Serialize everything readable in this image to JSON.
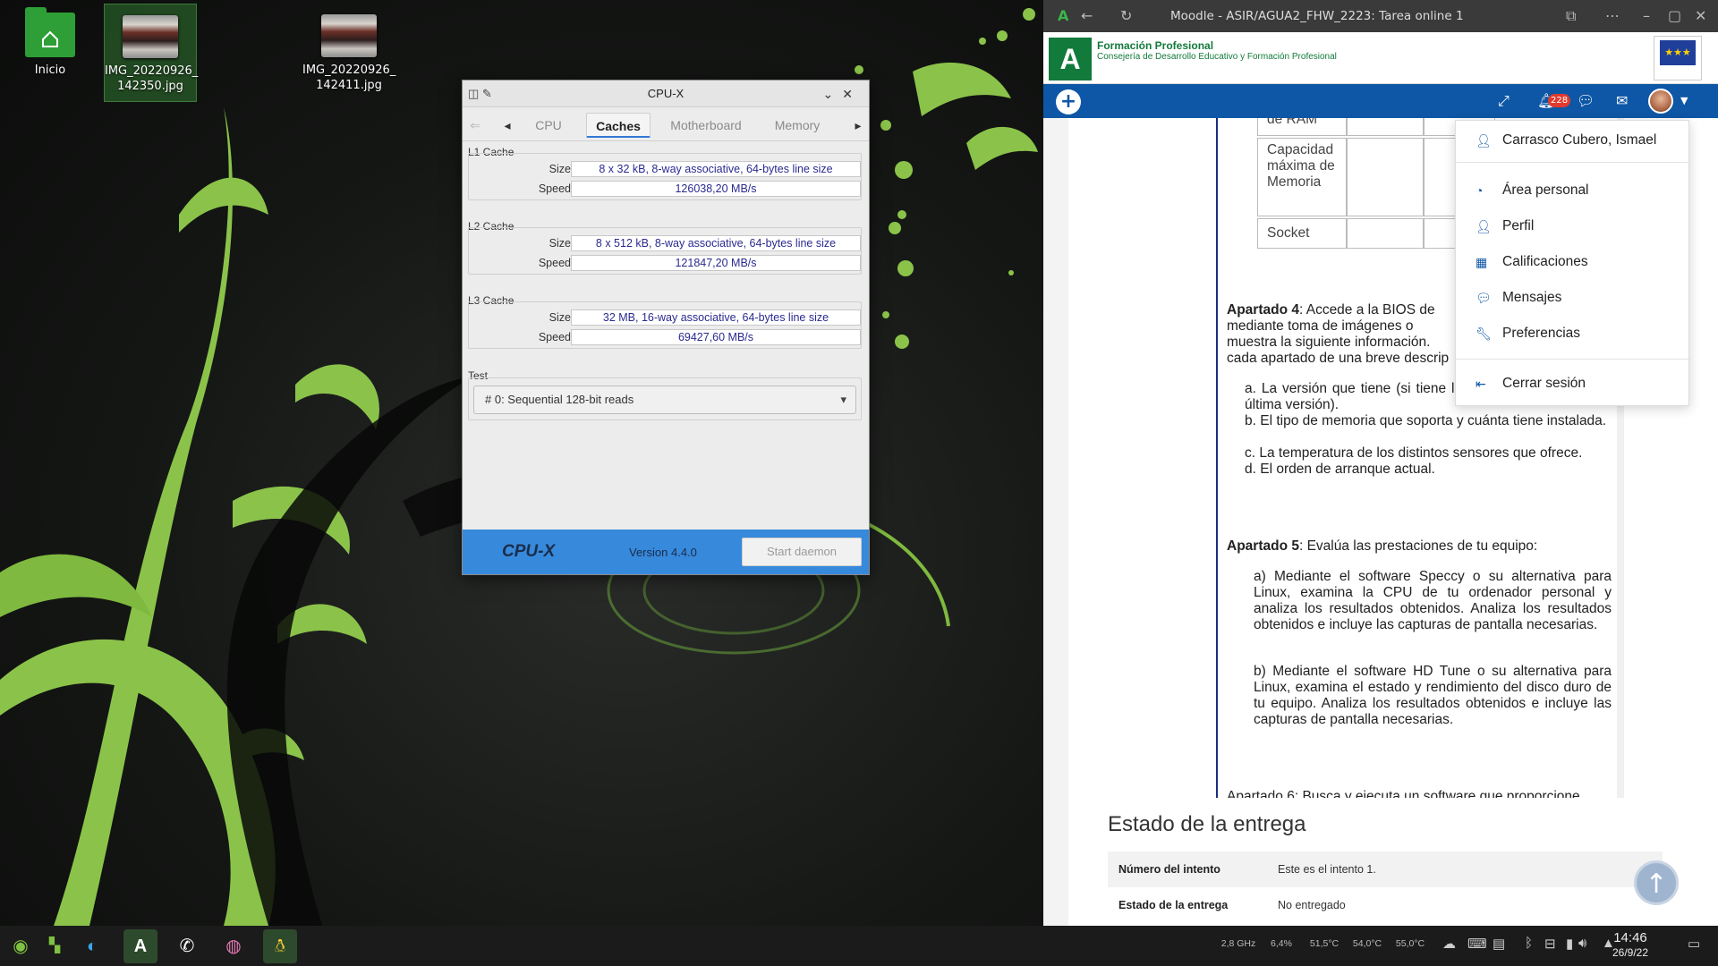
{
  "desktop": {
    "icons": [
      {
        "label": "Inicio"
      },
      {
        "label": "IMG_20220926_\n142350.jpg"
      },
      {
        "label": "IMG_20220926_\n142411.jpg"
      }
    ]
  },
  "cpux": {
    "title": "CPU-X",
    "tabs": [
      "CPU",
      "Caches",
      "Motherboard",
      "Memory"
    ],
    "active_tab": "Caches",
    "l1": {
      "title": "L1 Cache",
      "size_label": "Size",
      "size": "8 x 32 kB, 8-way associative, 64-bytes line size",
      "speed_label": "Speed",
      "speed": "126038,20 MB/s"
    },
    "l2": {
      "title": "L2 Cache",
      "size_label": "Size",
      "size": "8 x 512 kB, 8-way associative, 64-bytes line size",
      "speed_label": "Speed",
      "speed": "121847,20 MB/s"
    },
    "l3": {
      "title": "L3 Cache",
      "size_label": "Size",
      "size": "32 MB, 16-way associative, 64-bytes line size",
      "speed_label": "Speed",
      "speed": "69427,60 MB/s"
    },
    "test": {
      "title": "Test",
      "selected": "# 0: Sequential 128-bit reads"
    },
    "footer": {
      "brand": "CPU-X",
      "version": "Version 4.4.0",
      "button": "Start daemon"
    }
  },
  "browser": {
    "title": "Moodle - ASIR/AGUA2_FHW_2223: Tarea online 1",
    "header": {
      "line1": "Formación Profesional",
      "line2": "Consejería de Desarrollo Educativo y Formación Profesional"
    },
    "nav": {
      "notification_count": "228"
    },
    "table": {
      "row_partial": "de RAM",
      "row_capacity": "Capacidad máxima de Memoria",
      "row_socket": "Socket"
    },
    "apartado4": {
      "label": "Apartado 4",
      "text": ": Accede a la BIOS de mediante toma de imágenes o muestra la siguiente información. cada apartado de una breve descrip",
      "items": [
        "a. La versión que tiene (si tiene la la tiene, indica cuál es la última versión).",
        "b. El tipo de memoria que soporta y cuánta tiene instalada.",
        "c. La temperatura de los distintos sensores que ofrece.",
        "d. El orden de arranque actual."
      ]
    },
    "apartado5": {
      "label": "Apartado 5",
      "text": ": Evalúa las prestaciones de tu equipo:",
      "a": "a) Mediante el software Speccy o su alternativa para Linux, examina la CPU de tu ordenador personal y analiza los resultados obtenidos. Analiza los resultados obtenidos e incluye las capturas de pantalla necesarias.",
      "b": "b) Mediante el software HD Tune o su alternativa para Linux, examina el estado y rendimiento del disco duro de tu equipo. Analiza los resultados obtenidos e incluye las capturas de pantalla necesarias."
    },
    "apartado6_partial": "Apartado 6: Busca y ejecuta un software que proporcione",
    "user_menu": {
      "user": "Carrasco Cubero, Ismael",
      "items": [
        "Área personal",
        "Perfil",
        "Calificaciones",
        "Mensajes",
        "Preferencias"
      ],
      "logout": "Cerrar sesión"
    },
    "submission": {
      "title": "Estado de la entrega",
      "rows": [
        {
          "key": "Número del intento",
          "value": "Este es el intento 1."
        },
        {
          "key": "Estado de la entrega",
          "value": "No entregado"
        }
      ]
    }
  },
  "taskbar": {
    "sensors": [
      "2,8 GHz",
      "6,4%",
      "51,5°C",
      "54,0°C",
      "55,0°C"
    ],
    "time": "14:46",
    "date": "26/9/22"
  }
}
